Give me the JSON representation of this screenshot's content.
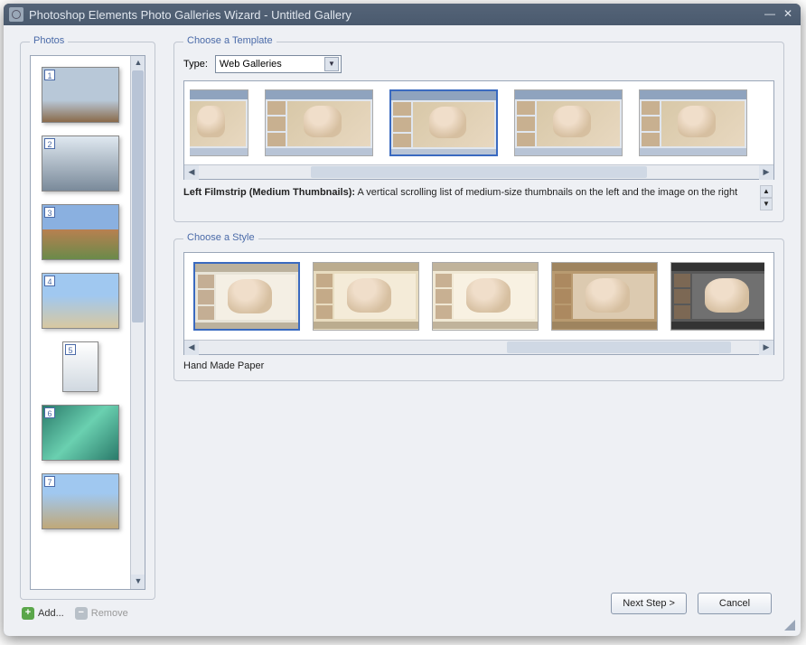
{
  "window": {
    "title": "Photoshop Elements Photo Galleries Wizard - Untitled Gallery"
  },
  "sections": {
    "photos": "Photos",
    "choose_template": "Choose a Template",
    "choose_style": "Choose a Style"
  },
  "photos": {
    "count": 7,
    "add_label": "Add...",
    "remove_label": "Remove"
  },
  "template": {
    "type_label": "Type:",
    "type_value": "Web Galleries",
    "selected_index": 2,
    "desc_title": "Left Filmstrip (Medium Thumbnails):",
    "desc_body": "A vertical scrolling list of medium-size thumbnails on the left and the image on the right"
  },
  "style": {
    "selected_index": 0,
    "selected_label": "Hand Made Paper"
  },
  "buttons": {
    "next": "Next Step >",
    "cancel": "Cancel"
  },
  "photo_numbers": [
    "1",
    "2",
    "3",
    "4",
    "5",
    "6",
    "7"
  ],
  "thumb_bg": [
    "linear-gradient(#b8c8d8 60%, #8a6a4a)",
    "linear-gradient(#dfe8f0, #7a8a9a)",
    "linear-gradient(#8ab0e0 45%, #b88050 45%, #6a8a4a)",
    "linear-gradient(#a0c8f0 40%, #d8c8a0)",
    "linear-gradient(#ffffff, #d0d8e0)",
    "linear-gradient(135deg,#2a7a6a,#6ad0b0,#2a7a6a)",
    "linear-gradient(#a0c8f0 35%, #c0a878)"
  ],
  "style_bg": [
    "#e8e4d8",
    "#e8dcc0",
    "#f0e8d4",
    "#b89a70",
    "#585858"
  ]
}
